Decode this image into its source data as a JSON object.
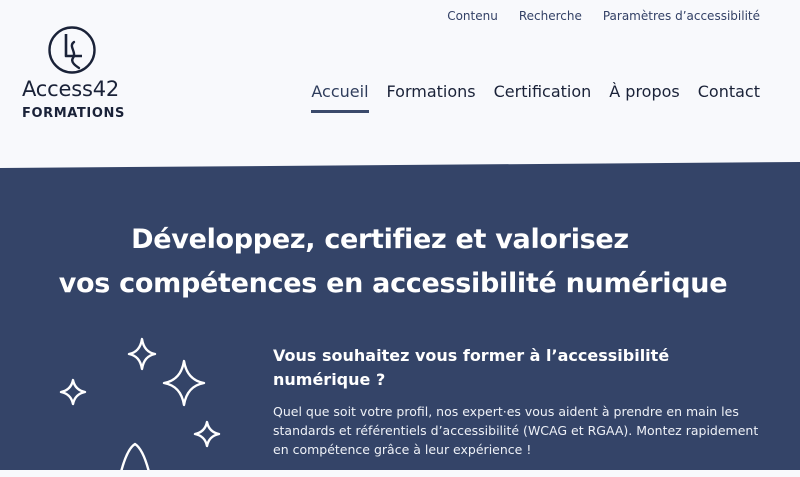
{
  "top_links": [
    "Contenu",
    "Recherche",
    "Paramètres d’accessibilité"
  ],
  "logo": {
    "name": "Access42",
    "subtitle": "FORMATIONS"
  },
  "nav": {
    "items": [
      "Accueil",
      "Formations",
      "Certification",
      "À propos",
      "Contact"
    ],
    "active": "Accueil"
  },
  "hero": {
    "title_line1": "Développez, certifiez et valorisez",
    "title_line2": "vos compétences en accessibilité numérique",
    "subheading": "Vous souhaitez vous former à l’accessibilité numérique ?",
    "text": "Quel que soit votre profil, nos expert·es vous aident à prendre en main les standards et référentiels d’accessibilité (WCAG et RGAA). Montez rapidement en compétence grâce à leur expérience !"
  },
  "colors": {
    "hero_bg": "#344468",
    "page_bg": "#f8f9fc",
    "text_dark": "#1a2238"
  }
}
